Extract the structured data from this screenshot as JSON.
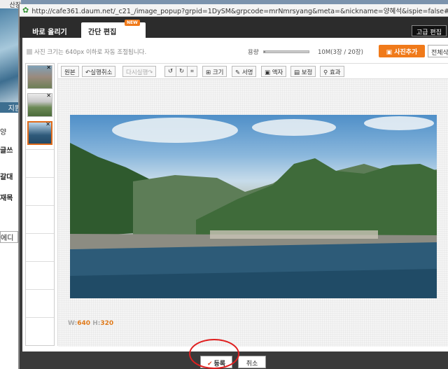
{
  "background": {
    "top_text": "산장",
    "items": [
      "지원",
      "양",
      "글쓰",
      "갈대",
      "재목",
      "에디"
    ]
  },
  "popup": {
    "url": "http://cafe361.daum.net/_c21_/image_popup?grpid=1DySM&grpcode=mrNmrsyang&meta=&nickname=양혜석&ispie=false#",
    "tabs": {
      "quick_upload": "바로 올리기",
      "simple_edit": "간단 편집",
      "new_badge": "NEW",
      "advanced_edit": "고급 편집"
    },
    "info": {
      "resize_notice": "사진 크기는 640px 이하로 자동 조절됩니다.",
      "capacity_label": "용량",
      "capacity_text": "10M(3장 / 20장)",
      "capacity_used_fraction": 0.03,
      "add_photo": "사진추가",
      "delete_all": "전체삭제"
    },
    "thumbnails": [
      {
        "name": "photo-1",
        "selected": false
      },
      {
        "name": "photo-2",
        "selected": false
      },
      {
        "name": "photo-3",
        "selected": true
      }
    ],
    "toolbar": {
      "original": "원본",
      "undo": "실행취소",
      "redo": "다시실행",
      "rotate_left": "↺",
      "rotate_right": "↻",
      "crop": "⌗",
      "resize": "크기",
      "signature": "서명",
      "frame": "액자",
      "correct": "보정",
      "effect": "효과"
    },
    "image": {
      "width_label": "W:",
      "width": "640",
      "height_label": "H:",
      "height": "320"
    },
    "footer": {
      "register": "등록",
      "cancel": "취소"
    },
    "colors": {
      "accent": "#f07a1a",
      "highlight_circle": "#e02020"
    }
  }
}
